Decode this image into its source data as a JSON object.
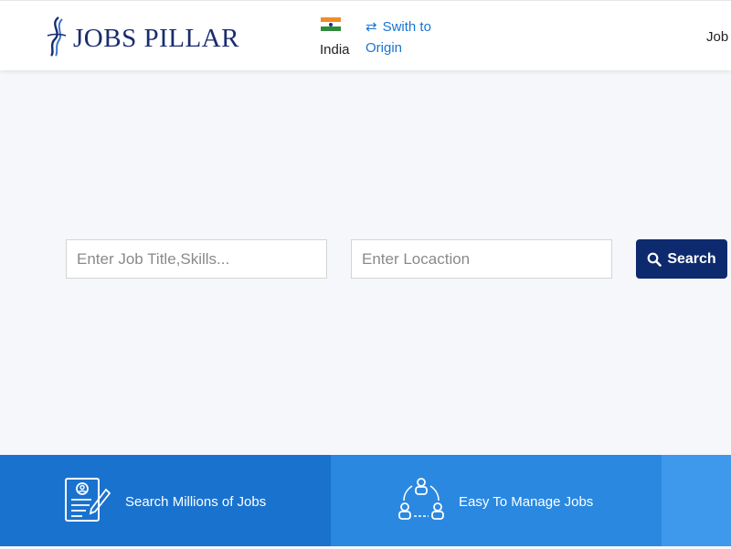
{
  "header": {
    "logo_text": "JOBS PILLAR",
    "country": {
      "name": "India",
      "flag_icon": "india-flag-icon"
    },
    "switch_link": {
      "icon": "swap-arrows-icon",
      "line1": "Swith to",
      "line2": "Origin"
    },
    "nav_partial": "Job"
  },
  "search": {
    "job_placeholder": "Enter Job Title,Skills...",
    "location_placeholder": "Enter Locaction",
    "button_label": "Search",
    "button_icon": "search-icon"
  },
  "features": [
    {
      "label": "Search Millions of Jobs",
      "icon": "resume-document-icon"
    },
    {
      "label": "Easy To Manage Jobs",
      "icon": "team-cycle-icon"
    }
  ],
  "colors": {
    "brand_navy": "#1a2c6e",
    "button_navy": "#0d2a6e",
    "link_blue": "#1a74d2",
    "feature_1": "#1a72cf",
    "feature_2": "#2a88e0",
    "feature_3": "#3e98ec"
  }
}
